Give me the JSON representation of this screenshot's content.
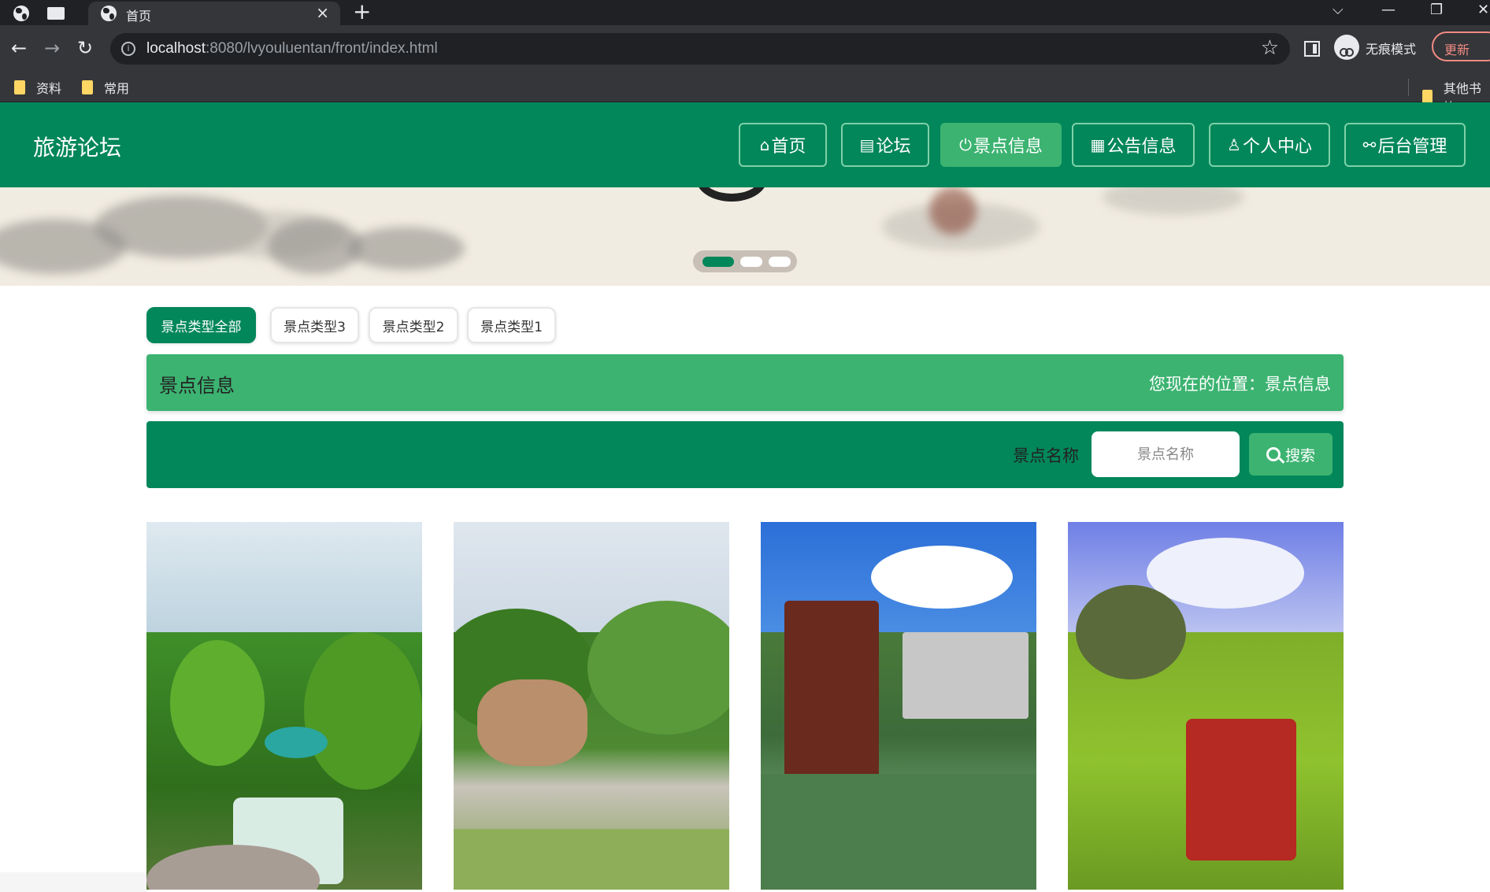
{
  "browser": {
    "tab_title": "首页",
    "tab_close": "×",
    "new_tab": "+",
    "url_host": "localhost",
    "url_rest": ":8080/lvyouluentan/front/index.html",
    "incognito_label": "无痕模式",
    "update_label": "更新",
    "window_controls": [
      "⌵",
      "—",
      "❐",
      "✕"
    ],
    "bookmarks": [
      "资料",
      "常用"
    ],
    "other_bookmarks": "其他书签"
  },
  "site": {
    "title": "旅游论坛",
    "nav": [
      {
        "icon": "⌂",
        "label": "首页"
      },
      {
        "icon": "▤",
        "label": "论坛"
      },
      {
        "icon": "⏻",
        "label": "景点信息"
      },
      {
        "icon": "▦",
        "label": "公告信息"
      },
      {
        "icon": "♙",
        "label": "个人中心"
      },
      {
        "icon": "⚯",
        "label": "后台管理"
      }
    ],
    "active_nav": "景点信息"
  },
  "banner": {
    "slides_total": 3,
    "active_slide": 1
  },
  "categories": [
    "景点类型全部",
    "景点类型3",
    "景点类型2",
    "景点类型1"
  ],
  "active_category": "景点类型全部",
  "title_bar": {
    "title": "景点信息",
    "location": "您现在的位置：景点信息"
  },
  "search": {
    "label": "景点名称",
    "placeholder": "景点名称",
    "button": "搜索"
  },
  "colors": {
    "header_green": "#02875a",
    "active_green": "#3cb371"
  }
}
